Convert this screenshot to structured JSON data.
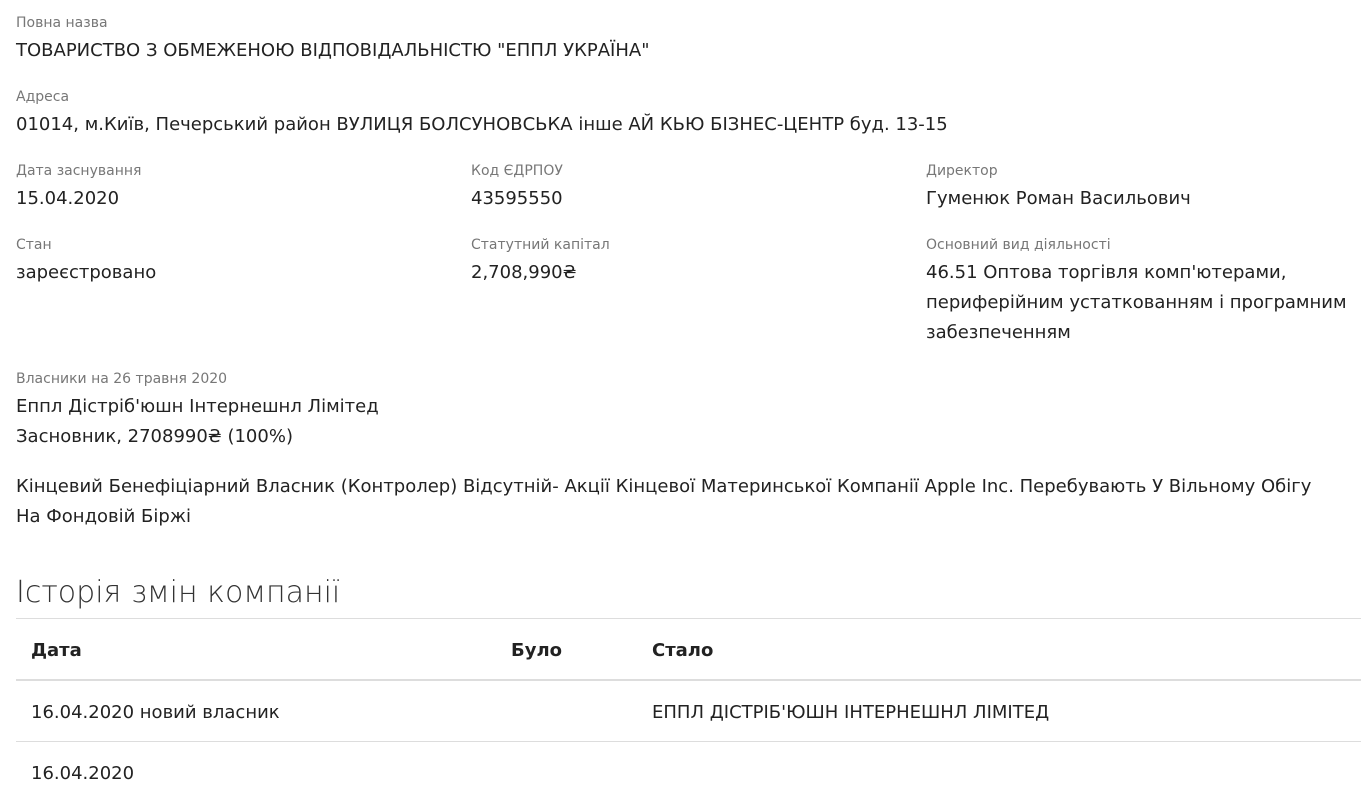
{
  "company": {
    "full_name_label": "Повна назва",
    "full_name": "ТОВАРИСТВО З ОБМЕЖЕНОЮ ВІДПОВІДАЛЬНІСТЮ \"ЕППЛ УКРАЇНА\"",
    "address_label": "Адреса",
    "address": "01014, м.Київ, Печерський район ВУЛИЦЯ БОЛСУНОВСЬКА інше АЙ КЬЮ БІЗНЕС-ЦЕНТР буд. 13-15",
    "founded_label": "Дата заснування",
    "founded": "15.04.2020",
    "edrpou_label": "Код ЄДРПОУ",
    "edrpou": "43595550",
    "director_label": "Директор",
    "director": "Гуменюк Роман Васильович",
    "status_label": "Стан",
    "status": "зареєстровано",
    "capital_label": "Статутний капітал",
    "capital": "2,708,990₴",
    "activity_label": "Основний вид діяльності",
    "activity": "46.51 Оптова торгівля комп'ютерами, периферійним устаткованням і програмним забезпеченням"
  },
  "owners": {
    "label": "Власники на 26 травня 2020",
    "owner_name": "Еппл Дістріб'юшн Інтернешнл Лімітед",
    "owner_role": "Засновник, 2708990₴ (100%)",
    "beneficiary": "Кінцевий Бенефіціарний Власник (Контролер) Відсутній- Акції Кінцевої Материнської Компанії Apple Inc. Перебувають У Вільному Обігу На Фондовій Біржі"
  },
  "history": {
    "title": "Історія змін компанії",
    "columns": {
      "date": "Дата",
      "was": "Було",
      "became": "Стало"
    },
    "rows": [
      {
        "date": "16.04.2020 новий власник",
        "was": "",
        "became": "ЕППЛ ДІСТРІБ'ЮШН ІНТЕРНЕШНЛ ЛІМІТЕД"
      },
      {
        "date": "16.04.2020",
        "was": "",
        "became": ""
      }
    ]
  }
}
